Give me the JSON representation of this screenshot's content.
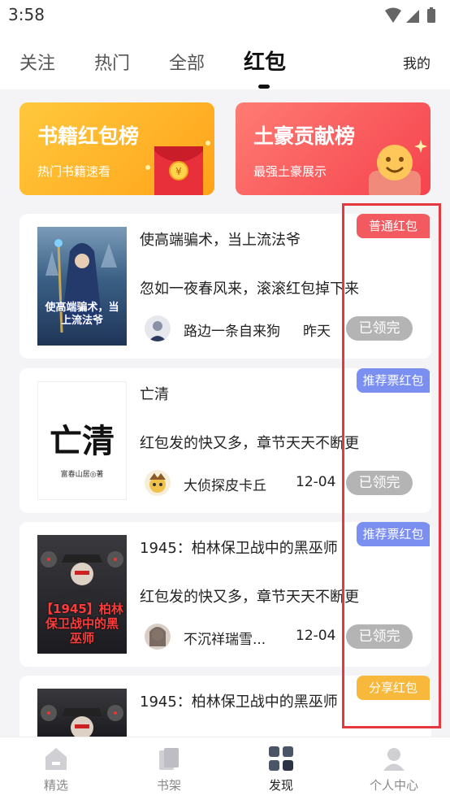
{
  "status_bar": {
    "time": "3:58"
  },
  "top_nav": {
    "tabs": [
      {
        "label": "关注"
      },
      {
        "label": "热门"
      },
      {
        "label": "全部"
      },
      {
        "label": "红包"
      }
    ],
    "active_tab": "红包",
    "mine_label": "我的"
  },
  "banners": [
    {
      "title": "书籍红包榜",
      "subtitle": "热门书籍速看"
    },
    {
      "title": "土豪贡献榜",
      "subtitle": "最强土豪展示"
    }
  ],
  "items": [
    {
      "title": "使高端骗术，当上流法爷",
      "desc": "忽如一夜春风来，滚滚红包掉下来",
      "author": "路边一条自来狗",
      "date": "昨天",
      "status": "已领完",
      "badge": "普通红包",
      "cover_text": "使高端骗术，当上流法爷"
    },
    {
      "title": "亡清",
      "desc": "红包发的快又多，章节天天不断更",
      "author": "大侦探皮卡丘",
      "date": "12-04",
      "status": "已领完",
      "badge": "推荐票红包",
      "cover_text": "亡清",
      "cover_sub": "富春山居◎著"
    },
    {
      "title": "1945：柏林保卫战中的黑巫师",
      "desc": "红包发的快又多，章节天天不断更",
      "author": "不沉祥瑞雪...",
      "date": "12-04",
      "status": "已领完",
      "badge": "推荐票红包",
      "cover_text": "【1945】柏林保卫战中的黑巫师"
    },
    {
      "title": "1945：柏林保卫战中的黑巫师",
      "badge": "分享红包"
    }
  ],
  "bottom_nav": {
    "items": [
      {
        "label": "精选",
        "icon": "home-icon"
      },
      {
        "label": "书架",
        "icon": "bookshelf-icon"
      },
      {
        "label": "发现",
        "icon": "discover-icon"
      },
      {
        "label": "个人中心",
        "icon": "profile-icon"
      }
    ],
    "active": "发现"
  },
  "colors": {
    "badge_red": "#f25a5f",
    "badge_blue": "#7b8ff0",
    "badge_orange": "#f7b83b",
    "highlight": "#e5393f",
    "status_grey": "#b4b4b4"
  }
}
